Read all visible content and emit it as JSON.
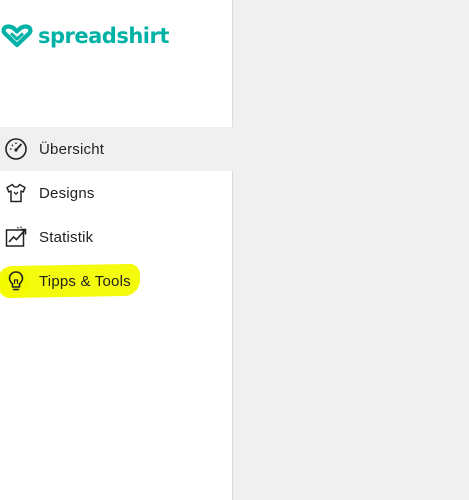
{
  "brand": {
    "name": "spreadshirt",
    "color": "#00b2a5"
  },
  "sidebar": {
    "items": [
      {
        "label": "Übersicht",
        "icon": "dashboard-gauge-icon",
        "active": true
      },
      {
        "label": "Designs",
        "icon": "tshirt-icon",
        "active": false
      },
      {
        "label": "Statistik",
        "icon": "chart-trend-icon",
        "active": false
      },
      {
        "label": "Tipps & Tools",
        "icon": "lightbulb-icon",
        "active": false,
        "highlighted": true
      }
    ]
  },
  "colors": {
    "active_bg": "#f0f0f0",
    "main_bg": "#f0f0f0",
    "highlight": "#f4fb00",
    "text": "#222222"
  }
}
